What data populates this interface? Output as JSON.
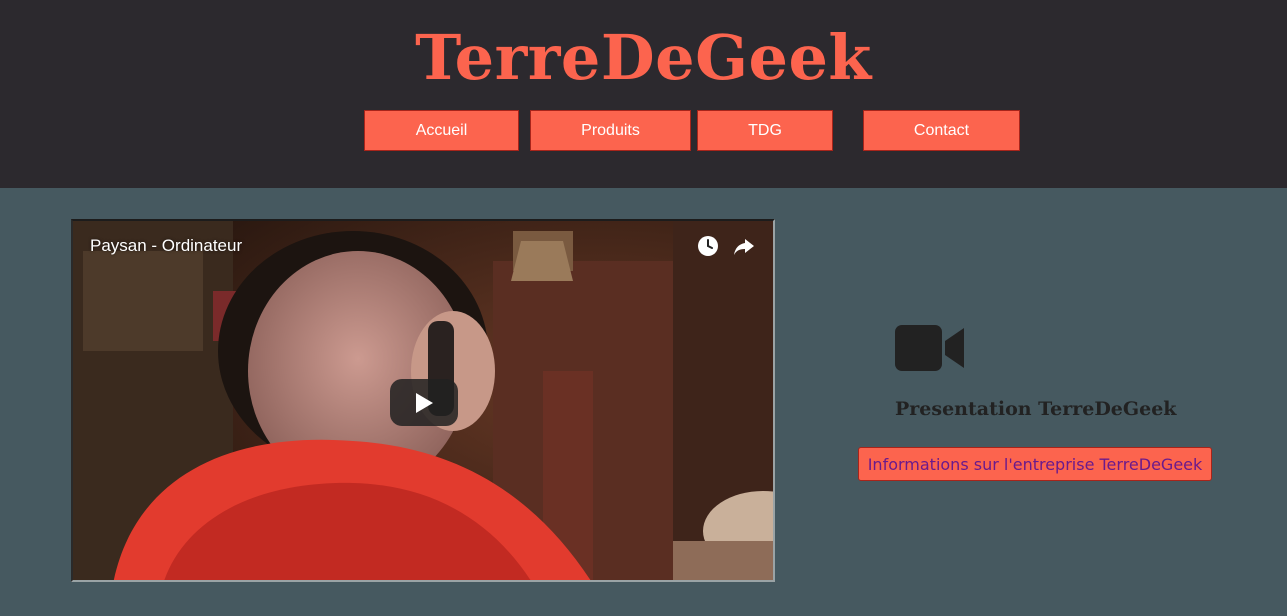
{
  "header": {
    "site_title": "TerreDeGeek",
    "nav": {
      "accueil": "Accueil",
      "produits": "Produits",
      "tdg": "TDG",
      "contact": "Contact"
    }
  },
  "video": {
    "title": "Paysan - Ordinateur",
    "icons": [
      "clock-icon",
      "share-icon",
      "play-icon"
    ]
  },
  "aside": {
    "icon": "video-camera-icon",
    "heading": "Presentation TerreDeGeek",
    "link_label": "Informations sur l'entreprise TerreDeGeek"
  },
  "colors": {
    "header_bg": "#2c292e",
    "page_bg": "#465960",
    "accent": "#fc644e",
    "link_text": "#6b1a8c"
  }
}
